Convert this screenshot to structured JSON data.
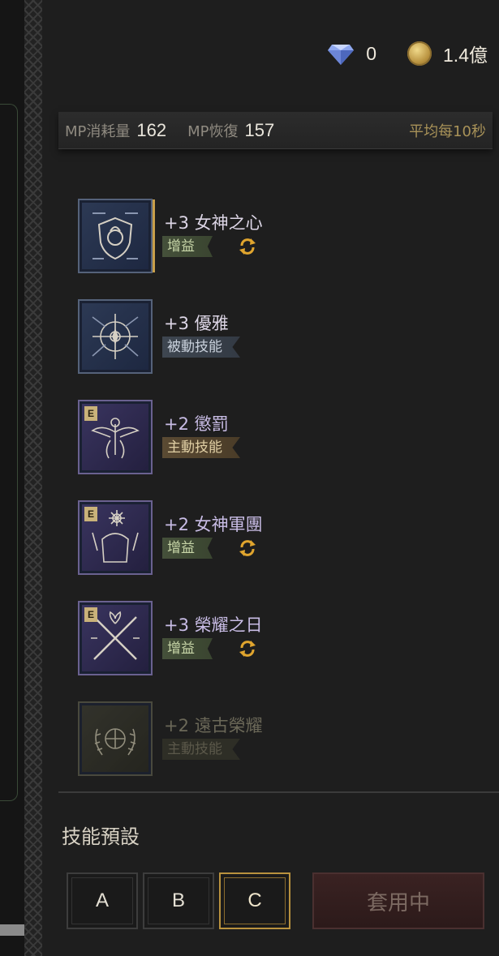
{
  "currency": {
    "diamond_value": "0",
    "gold_value": "1.4億",
    "diamond_icon": "diamond-icon",
    "gold_icon": "gold-coin-icon"
  },
  "mp": {
    "consume_label": "MP消耗量",
    "consume_value": "162",
    "recover_label": "MP恢復",
    "recover_value": "157",
    "average_label": "平均每10秒"
  },
  "skills": [
    {
      "name": "+3 女神之心",
      "tag": "增益",
      "tag_type": "buff",
      "cycle": true,
      "badge": "",
      "icon": "heart-shield-icon"
    },
    {
      "name": "+3 優雅",
      "tag": "被動技能",
      "tag_type": "passive",
      "cycle": false,
      "badge": "",
      "icon": "compass-star-icon"
    },
    {
      "name": "+2 懲罰",
      "tag": "主動技能",
      "tag_type": "active",
      "cycle": false,
      "badge": "E",
      "icon": "winged-emblem-icon"
    },
    {
      "name": "+2 女神軍團",
      "tag": "增益",
      "tag_type": "buff",
      "cycle": true,
      "badge": "E",
      "icon": "legion-sun-icon"
    },
    {
      "name": "+3 榮耀之日",
      "tag": "增益",
      "tag_type": "buff",
      "cycle": true,
      "badge": "E",
      "icon": "crossed-swords-icon"
    },
    {
      "name": "+2 遠古榮耀",
      "tag": "主動技能",
      "tag_type": "dim",
      "cycle": false,
      "badge": "",
      "icon": "laurel-wreath-icon"
    }
  ],
  "preset": {
    "title": "技能預設",
    "buttons": [
      "A",
      "B",
      "C"
    ],
    "selected": "C",
    "apply_label": "套用中"
  },
  "colors": {
    "gold_accent": "#b9923e",
    "buff_tag": "#45503a",
    "active_tag": "#5a4a33",
    "passive_tag": "#3e4650"
  }
}
